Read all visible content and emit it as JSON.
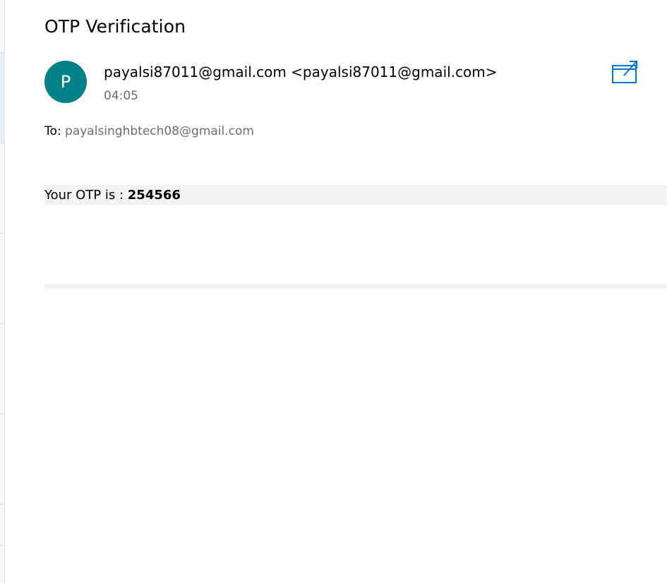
{
  "email": {
    "subject": "OTP Verification",
    "avatar_initial": "P",
    "sender": "payalsi87011@gmail.com <payalsi87011@gmail.com>",
    "time": "04:05",
    "to_label": "To: ",
    "to_address": "payalsinghbtech08@gmail.com",
    "body": {
      "otp_prefix": "Your OTP is : ",
      "otp_code": "254566"
    }
  },
  "icons": {
    "popout": "open-in-new-window-icon"
  },
  "colors": {
    "avatar_bg": "#038387",
    "accent": "#0078d4",
    "muted_text": "#6e6e6e"
  }
}
